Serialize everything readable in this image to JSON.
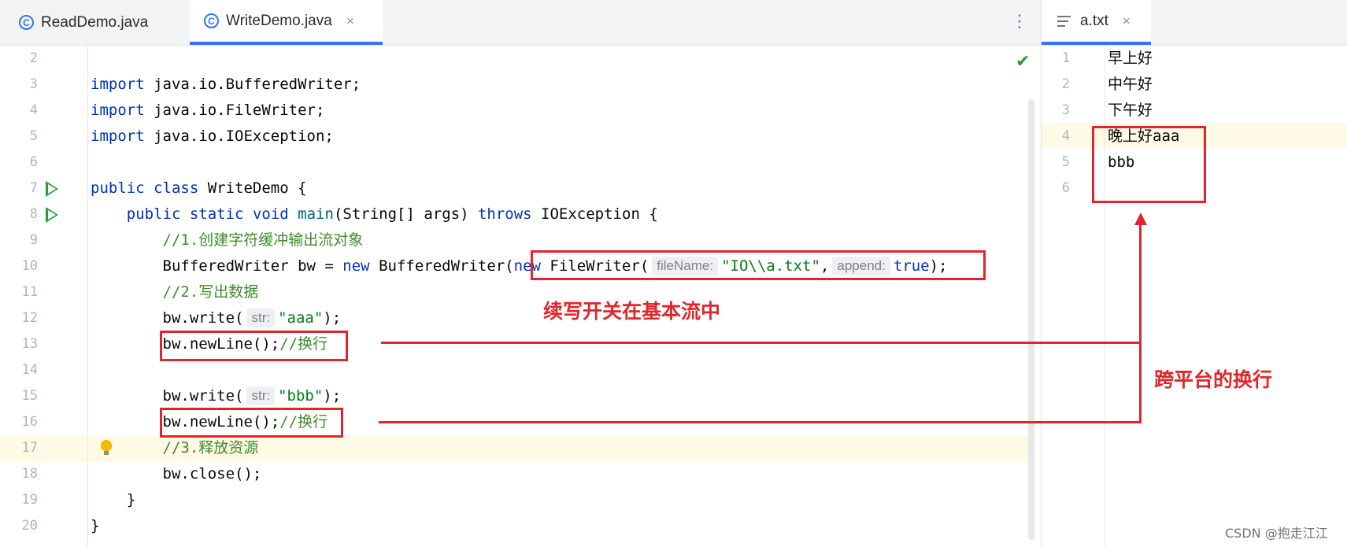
{
  "tabs": {
    "left": [
      {
        "label": "ReadDemo.java",
        "icon": "java-class-icon",
        "active": false
      },
      {
        "label": "WriteDemo.java",
        "icon": "java-class-icon",
        "active": true,
        "close": "×"
      }
    ],
    "more_icon": "⋮",
    "right": {
      "label": "a.txt",
      "icon": "text-file-icon",
      "close": "×"
    }
  },
  "editor": {
    "check_icon": "✔",
    "lines": [
      {
        "n": "2"
      },
      {
        "n": "3"
      },
      {
        "n": "4"
      },
      {
        "n": "5"
      },
      {
        "n": "6"
      },
      {
        "n": "7"
      },
      {
        "n": "8"
      },
      {
        "n": "9"
      },
      {
        "n": "10"
      },
      {
        "n": "11"
      },
      {
        "n": "12"
      },
      {
        "n": "13"
      },
      {
        "n": "14"
      },
      {
        "n": "15"
      },
      {
        "n": "16"
      },
      {
        "n": "17"
      },
      {
        "n": "18"
      },
      {
        "n": "19"
      },
      {
        "n": "20"
      }
    ],
    "tokens": {
      "import": "import",
      "imp1": " java.io.BufferedWriter;",
      "imp2": " java.io.FileWriter;",
      "imp3": " java.io.IOException;",
      "public": "public",
      "class": "class",
      "class_name": " WriteDemo {",
      "static": "static",
      "void": "void",
      "main": "main",
      "main_params": "(String[] args) ",
      "throws": "throws",
      "main_end": " IOException {",
      "c1": "//1.创建字符缓冲输出流对象",
      "bw_decl": "BufferedWriter bw = ",
      "new": "new",
      "bw_ctor": " BufferedWriter(",
      "fw": " FileWriter(",
      "hint_filename": "fileName:",
      "path": "\"IO\\\\a.txt\"",
      "comma": ",",
      "hint_append": "append:",
      "true": "true",
      "end10": ");",
      "c2": "//2.写出数据",
      "write": "bw.write(",
      "hint_str": "str:",
      "aaa": "\"aaa\"",
      "bbb": "\"bbb\"",
      "close_paren": ");",
      "newline": "bw.newLine();",
      "c_newline": "//换行",
      "c3": "//3.释放资源",
      "close": "bw.close();",
      "rbrace": "}"
    }
  },
  "file": {
    "lines": [
      {
        "n": "1",
        "text": "早上好"
      },
      {
        "n": "2",
        "text": "中午好"
      },
      {
        "n": "3",
        "text": "下午好"
      },
      {
        "n": "4",
        "text": "晚上好aaa"
      },
      {
        "n": "5",
        "text": "bbb"
      },
      {
        "n": "6",
        "text": ""
      }
    ]
  },
  "annotations": {
    "append_switch": "续写开关在基本流中",
    "cross_platform": "跨平台的换行"
  },
  "watermark": "CSDN @抱走江江"
}
